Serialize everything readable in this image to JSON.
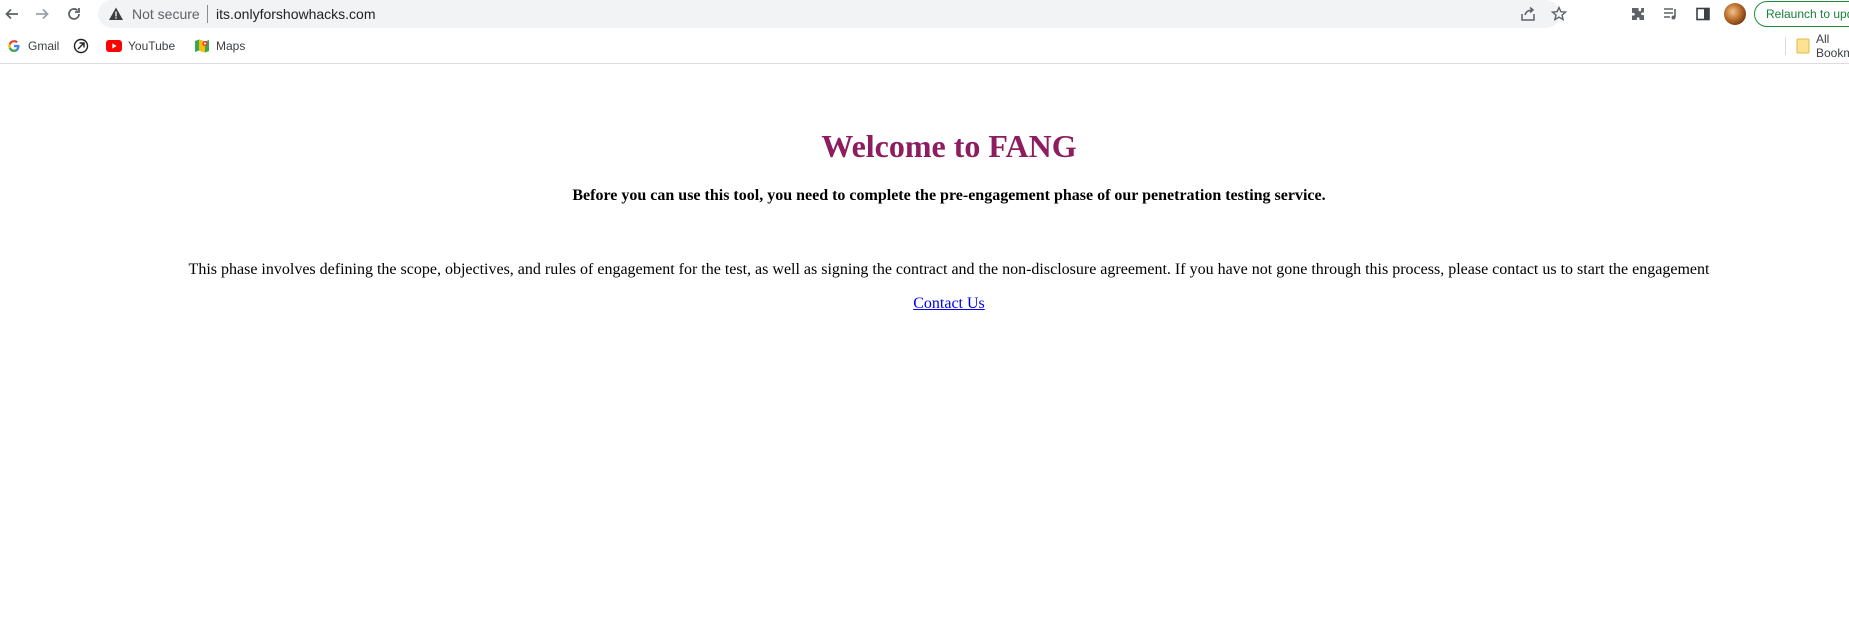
{
  "browser": {
    "security_label": "Not secure",
    "url": "its.onlyforshowhacks.com",
    "relaunch_label": "Relaunch to update",
    "icons": [
      "back-icon",
      "forward-icon",
      "reload-icon",
      "warning-icon",
      "share-icon",
      "star-icon",
      "extensions-icon",
      "media-icon",
      "side-panel-icon"
    ]
  },
  "bookmarks": {
    "items": [
      {
        "label": "Gmail",
        "icon": "google-icon"
      },
      {
        "label": "",
        "icon": "app-shortcut-icon"
      },
      {
        "label": "YouTube",
        "icon": "youtube-icon"
      },
      {
        "label": "Maps",
        "icon": "maps-icon"
      }
    ],
    "all_bookmarks_label": "All Bookmarks"
  },
  "page": {
    "title": "Welcome to FANG",
    "subtitle": "Before you can use this tool, you need to complete the pre-engagement phase of our penetration testing service.",
    "paragraph": "This phase involves defining the scope, objectives, and rules of engagement for the test, as well as signing the contract and the non-disclosure agreement. If you have not gone through this process, please contact us to start the engagement",
    "contact_link": "Contact Us"
  },
  "colors": {
    "title": "#8e1d5f",
    "link": "#0000ee",
    "relaunch_border": "#1e8e3e"
  }
}
